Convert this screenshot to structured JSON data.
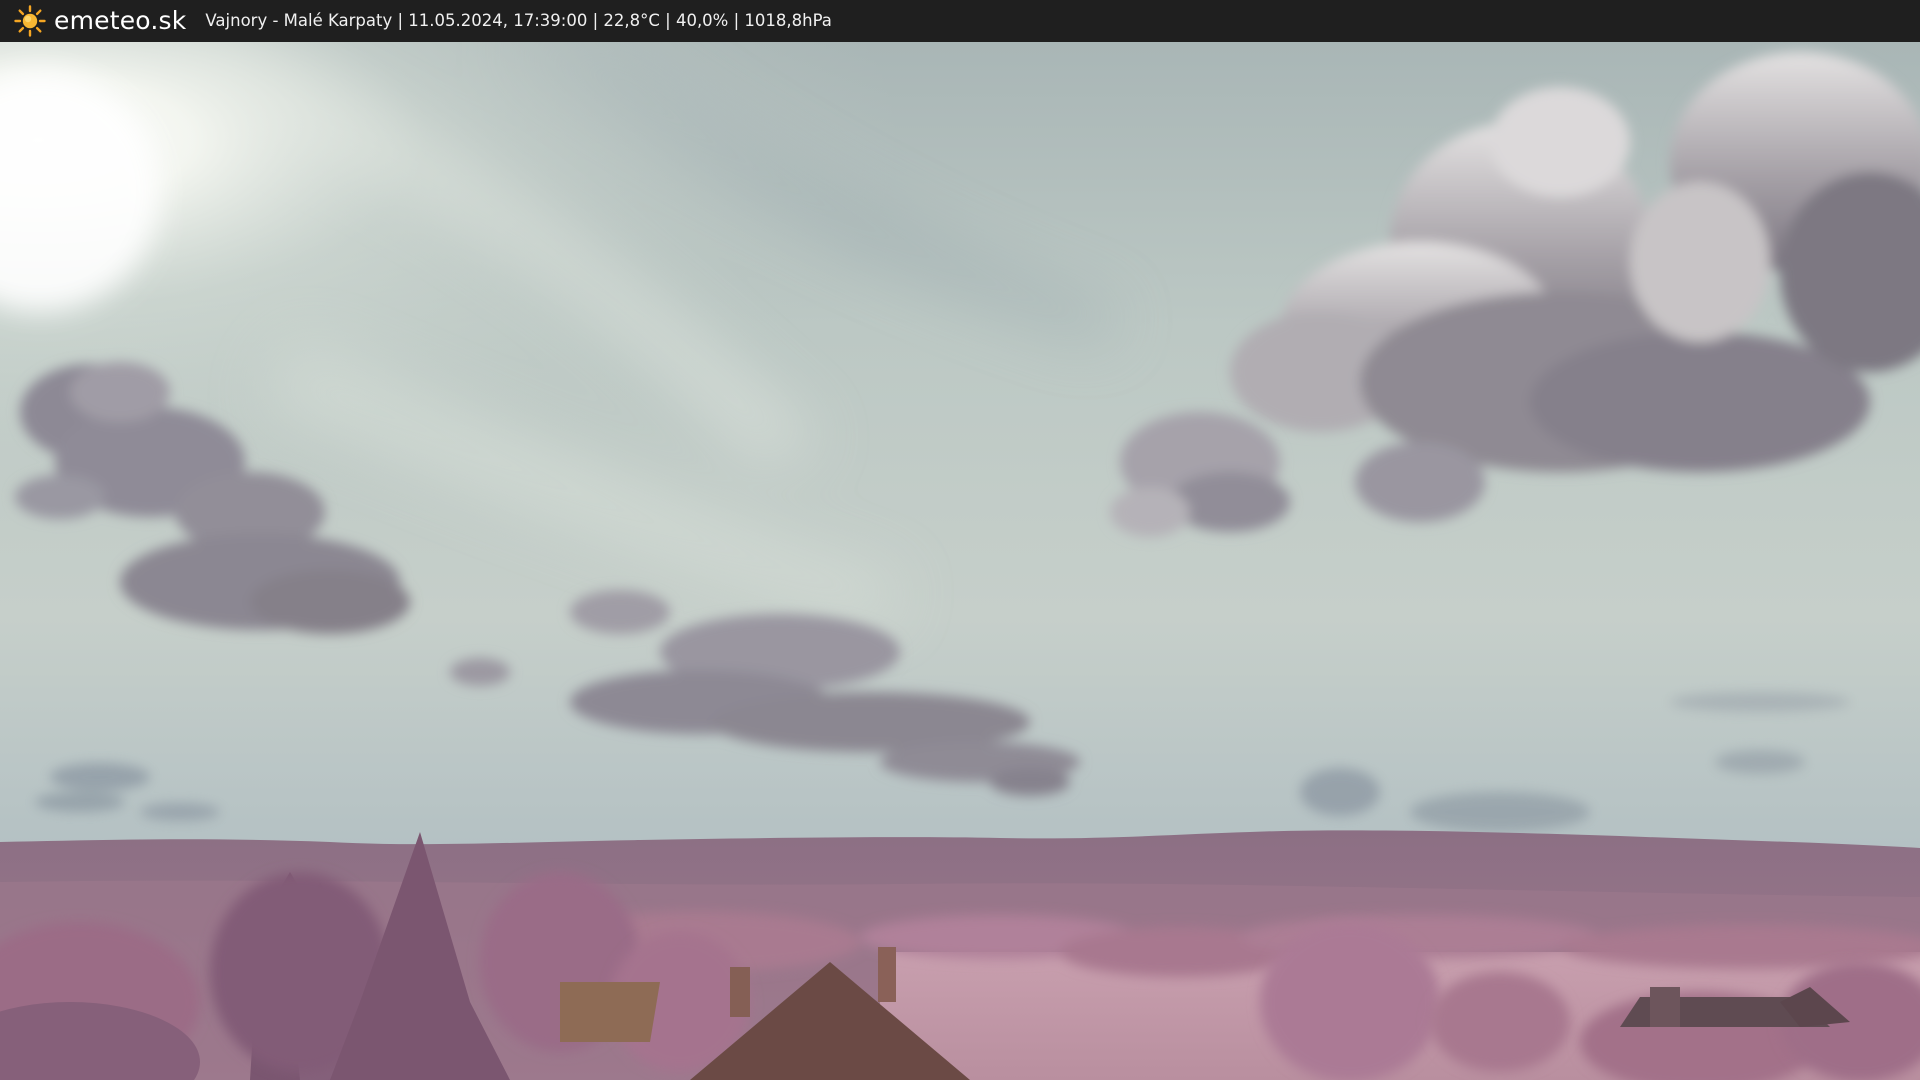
{
  "header": {
    "brand": "emeteo.sk",
    "icon": "sun-icon",
    "caption": "Vajnory - Malé Karpaty | 11.05.2024, 17:39:00 | 22,8°C | 40,0% | 1018,8hPa"
  },
  "colors": {
    "bar_background": "#1f1f1f",
    "sun_icon": "#f5a623",
    "sky": "#b9c6c2",
    "cloud_shadow": "#8a8590",
    "foliage": "#a9738f"
  }
}
